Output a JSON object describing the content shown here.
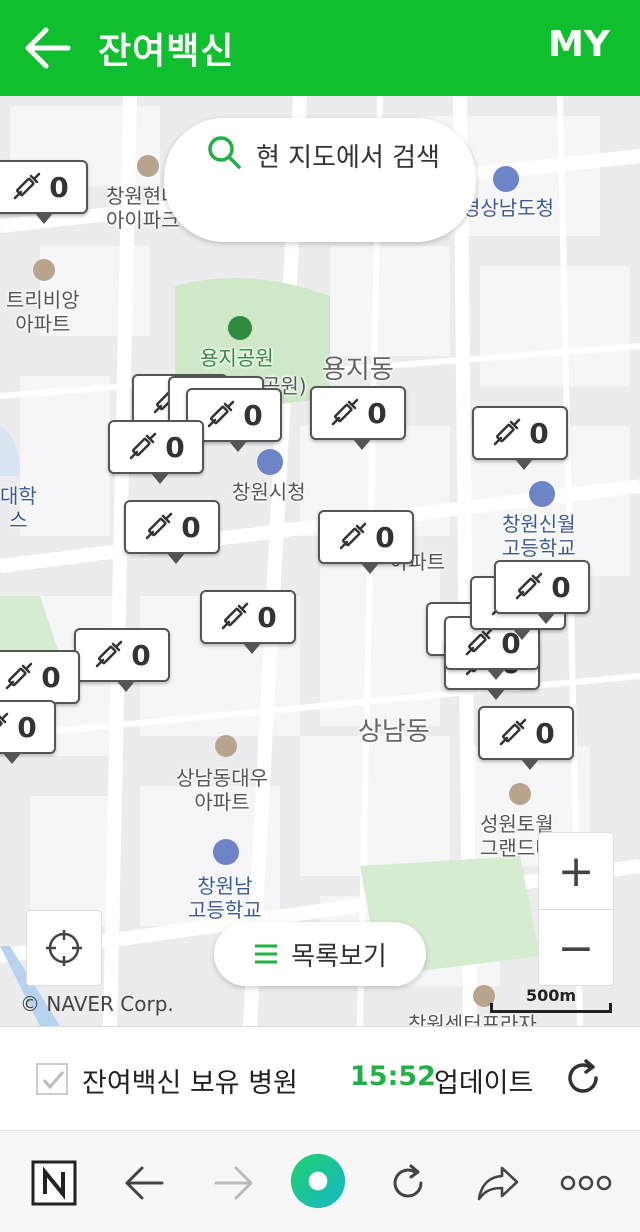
{
  "header": {
    "title": "잔여백신",
    "my_label": "MY"
  },
  "search": {
    "text": "현 지도에서 검색"
  },
  "map": {
    "labels": {
      "yongji_park": "용지공원",
      "yongji_park_sub": "공원)",
      "yongji_dong": "용지동",
      "city_hall": "창원시청",
      "gov_office": "경상남도청",
      "tribiang": "트리비앙",
      "apartment": "아파트",
      "changwon_hyundai": "창원현대",
      "ipark": "아이파크",
      "univ": "대학",
      "univ_sub": "스",
      "sinwol1": "창원신월",
      "sinwol2": "고등학교",
      "apt_partial": "아파트",
      "sangnam_dong": "상남동",
      "sangnam_daewoo": "상남동대우",
      "sangnam_daewoo2": "아파트",
      "seongwon1": "성원토월",
      "seongwon2": "그랜드타",
      "changwonnam1": "창원남",
      "changwonnam2": "고등학교",
      "center_partial": "창원센터프라자"
    },
    "markers_count": "0",
    "copyright": "© NAVER Corp.",
    "scale_label": "500m",
    "list_button": "목록보기",
    "zoom_in": "+",
    "zoom_out": "−"
  },
  "bottom": {
    "checkbox_label": "잔여백신 보유 병원",
    "update_time": "15:52",
    "update_label": "업데이트"
  },
  "icons": {
    "back": "arrow-left-icon",
    "search": "search-icon",
    "syringe": "syringe-icon",
    "locate": "locate-icon",
    "list": "list-icon",
    "refresh": "refresh-icon"
  },
  "colors": {
    "brand_green": "#0fbf2e",
    "update_time": "#20b045",
    "marker_border": "#555555"
  }
}
